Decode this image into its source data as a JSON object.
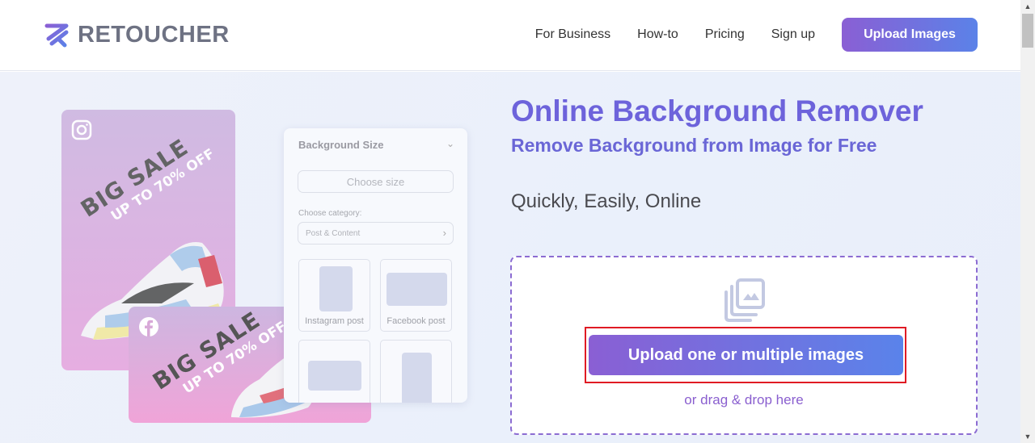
{
  "header": {
    "brand": "RETOUCHER",
    "nav": [
      "For Business",
      "How-to",
      "Pricing",
      "Sign up"
    ],
    "cta_label": "Upload Images",
    "brand_gradient": [
      "#8a5fd4",
      "#5b82e8"
    ]
  },
  "illustration": {
    "instagram_card": {
      "icon": "instagram-icon",
      "headline": "BIG SALE",
      "subline": "UP TO 70% OFF"
    },
    "facebook_card": {
      "icon": "facebook-icon",
      "headline": "BIG SALE",
      "subline": "UP TO 70% OFF"
    },
    "size_panel": {
      "title": "Background Size",
      "choose_size": "Choose size",
      "category_label": "Choose category:",
      "category_value": "Post & Content",
      "tiles": [
        "Instagram post",
        "Facebook post",
        "",
        ""
      ]
    }
  },
  "hero": {
    "title": "Online Background Remover",
    "subtitle": "Remove Background from Image for Free",
    "tagline": "Quickly, Easily, Online",
    "upload_button": "Upload one or multiple images",
    "drag_text": "or drag & drop here",
    "title_color": "#6d63db",
    "dropzone_border_color": "#8c6cd2",
    "highlight_color": "#e01b24"
  }
}
